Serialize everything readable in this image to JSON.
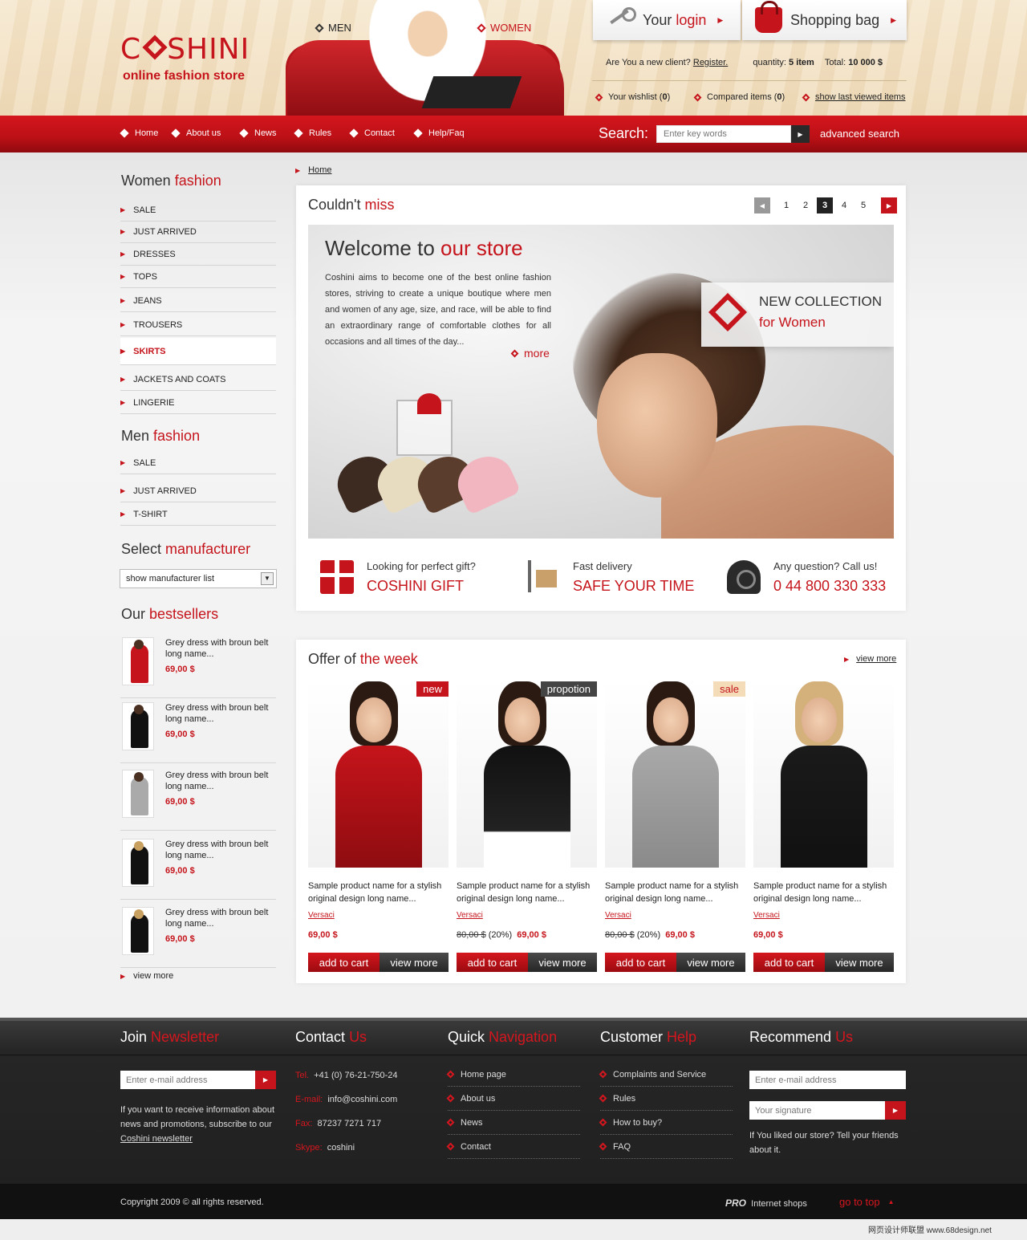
{
  "colors": {
    "accent": "#c5141b",
    "dark": "#222222",
    "footer_bg": "#1f1f1f"
  },
  "brand": {
    "logo": "CSHINI",
    "logo_prefix": "C",
    "logo_suffix": "SHINI",
    "tagline": "online fashion store"
  },
  "header": {
    "gender_men": "MEN",
    "gender_women": "WOMEN",
    "login_label_a": "Your",
    "login_label_b": "login",
    "bag_label_a": "Shopping",
    "bag_label_b": "bag",
    "new_client": "Are You a new client?",
    "register": "Register.",
    "quantity_label": "quantity:",
    "quantity_value": "5 item",
    "total_label": "Total:",
    "total_value": "10 000 $",
    "wishlist_label": "Your wishlist (",
    "wishlist_count": "0",
    "compared_label": "Compared items (",
    "compared_count": "0",
    "paren_close": ")",
    "last_viewed": "show last viewed items"
  },
  "nav": {
    "items": [
      "Home",
      "About us",
      "News",
      "Rules",
      "Contact",
      "Help/Faq"
    ],
    "search_label": "Search:",
    "search_placeholder": "Enter key words",
    "advanced": "advanced search"
  },
  "sidebar": {
    "women_title_a": "Women",
    "women_title_b": "fashion",
    "women_items": [
      "SALE",
      "JUST ARRIVED",
      "DRESSES",
      "TOPS",
      "JEANS",
      "TROUSERS",
      "SKIRTS",
      "JACKETS AND COATS",
      "LINGERIE"
    ],
    "men_title_a": "Men",
    "men_title_b": "fashion",
    "men_items": [
      "SALE",
      "JUST ARRIVED",
      "T-SHIRT"
    ],
    "manu_title_a": "Select",
    "manu_title_b": "manufacturer",
    "manu_select": "show manufacturer list",
    "best_title_a": "Our",
    "best_title_b": "bestsellers",
    "bestsellers": [
      {
        "name": "Grey dress with broun belt long name...",
        "price": "69,00 $"
      },
      {
        "name": "Grey dress with broun belt long name...",
        "price": "69,00 $"
      },
      {
        "name": "Grey dress with broun belt long name...",
        "price": "69,00 $"
      },
      {
        "name": "Grey dress with broun belt long name...",
        "price": "69,00 $"
      },
      {
        "name": "Grey dress with broun belt long name...",
        "price": "69,00 $"
      }
    ],
    "view_more": "view more"
  },
  "breadcrumb": "Home",
  "featured": {
    "title_a": "Couldn't",
    "title_b": "miss",
    "pages": [
      "1",
      "2",
      "3",
      "4",
      "5"
    ],
    "active_page": "3",
    "banner_title_a": "Welcome to",
    "banner_title_b": "our store",
    "banner_text": "Coshini aims to become one of the best online fashion stores, striving to create a unique boutique where men and women of any age, size, and race, will be able to find an extraordinary range of comfortable clothes for all occasions and all times of the day...",
    "banner_more": "more",
    "collection_a": "NEW COLLECTION",
    "collection_b": "for Women",
    "features": [
      {
        "line1": "Looking for perfect gift?",
        "line2": "COSHINI GIFT",
        "icon": "gift-icon"
      },
      {
        "line1": "Fast delivery",
        "line2": "SAFE YOUR TIME",
        "icon": "delivery-cart-icon"
      },
      {
        "line1": "Any question? Call us!",
        "line2": "0 44 800 330 333",
        "icon": "telephone-icon"
      }
    ]
  },
  "offer": {
    "title_a": "Offer of",
    "title_b": "the week",
    "view_more": "view more",
    "cart_label": "add to cart",
    "view_label": "view more",
    "products": [
      {
        "badge": "new",
        "name": "Sample product name for a stylish original design long name...",
        "brand": "Versaci",
        "old_price": "",
        "discount": "",
        "price": "69,00 $"
      },
      {
        "badge": "propotion",
        "name": "Sample product name for a stylish original design long name...",
        "brand": "Versaci",
        "old_price": "80,00 $",
        "discount": "(20%)",
        "price": "69,00 $"
      },
      {
        "badge": "sale",
        "name": "Sample product name for a stylish original design long name...",
        "brand": "Versaci",
        "old_price": "80,00 $",
        "discount": "(20%)",
        "price": "69,00 $"
      },
      {
        "badge": "",
        "name": "Sample product name for a stylish original design long name...",
        "brand": "Versaci",
        "old_price": "",
        "discount": "",
        "price": "69,00 $"
      }
    ]
  },
  "footer": {
    "newsletter_title_a": "Join",
    "newsletter_title_b": "Newsletter",
    "newsletter_placeholder": "Enter e-mail address",
    "newsletter_text": "If you want to receive information about news and promotions, subscribe to our",
    "newsletter_link": "Coshini newsletter",
    "contact_title_a": "Contact",
    "contact_title_b": "Us",
    "contact": [
      {
        "label": "Tel.",
        "value": "+41 (0) 76-21-750-24"
      },
      {
        "label": "E-mail:",
        "value": "info@coshini.com"
      },
      {
        "label": "Fax:",
        "value": "87237 7271 717"
      },
      {
        "label": "Skype:",
        "value": "coshini"
      }
    ],
    "nav_title_a": "Quick",
    "nav_title_b": "Navigation",
    "nav_links": [
      "Home page",
      "About us",
      "News",
      "Contact"
    ],
    "help_title_a": "Customer",
    "help_title_b": "Help",
    "help_links": [
      "Complaints and Service",
      "Rules",
      "How to buy?",
      "FAQ"
    ],
    "recommend_title_a": "Recommend",
    "recommend_title_b": "Us",
    "recommend_email": "Enter e-mail address",
    "recommend_signature": "Your signature",
    "recommend_text": "If You liked our store? Tell your friends about it.",
    "copyright": "Copyright 2009 ©  all rights reserved.",
    "pro_brand": "PRO",
    "pro_text": "Internet shops",
    "go_top": "go to top"
  },
  "watermark": "网页设计师联盟 www.68design.net"
}
